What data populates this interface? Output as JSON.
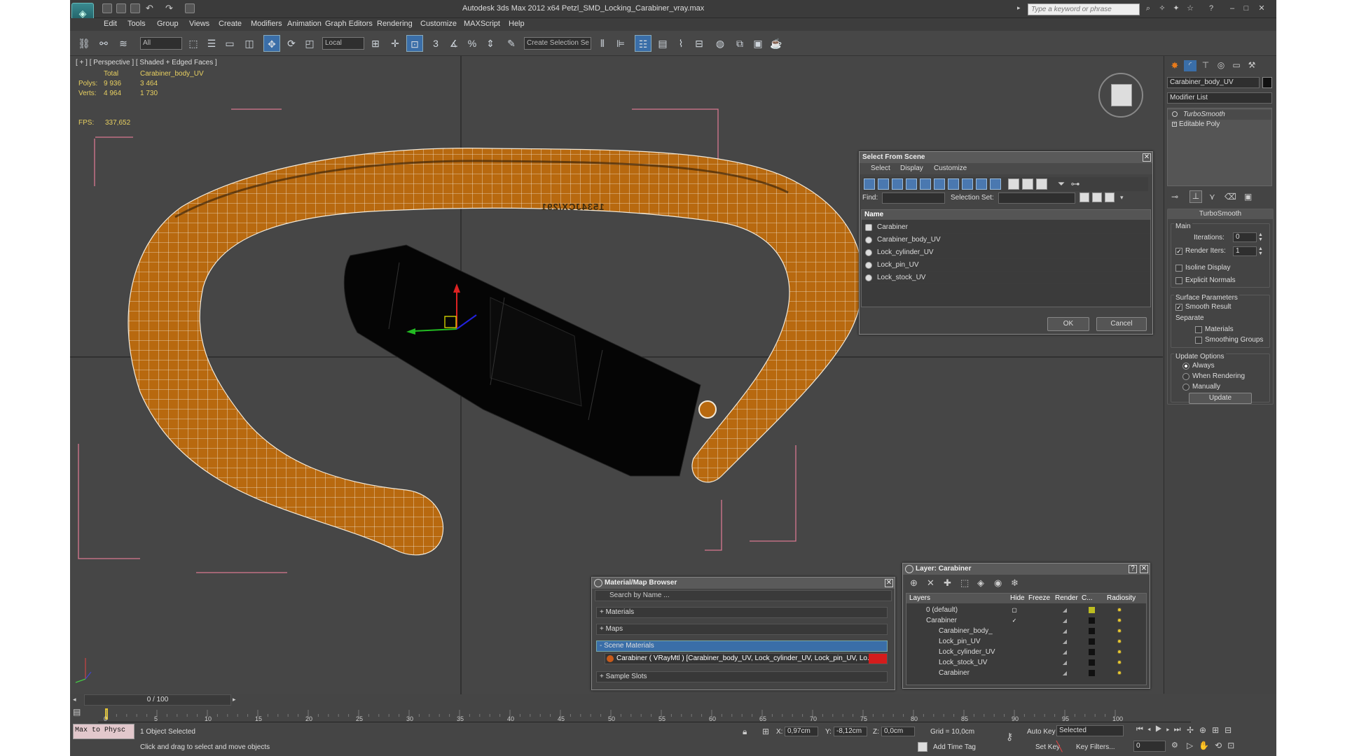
{
  "window": {
    "title": "Autodesk 3ds Max  2012 x64     Petzl_SMD_Locking_Carabiner_vray.max",
    "search_placeholder": "Type a keyword or phrase"
  },
  "menu": [
    "Edit",
    "Tools",
    "Group",
    "Views",
    "Create",
    "Modifiers",
    "Animation",
    "Graph Editors",
    "Rendering",
    "Customize",
    "MAXScript",
    "Help"
  ],
  "toolbar": {
    "filter": "All",
    "coord_system": "Local",
    "selection_set": "Create Selection Se",
    "snap_3": "3",
    "snap_pct": "%"
  },
  "viewport": {
    "label": "[ + ] [ Perspective ] [ Shaded + Edged Faces ]",
    "stats": {
      "total_label": "Total",
      "object_label": "Carabiner_body_UV",
      "polys_label": "Polys:",
      "polys_total": "9 936",
      "polys_obj": "3 464",
      "verts_label": "Verts:",
      "verts_total": "4 964",
      "verts_obj": "1 730",
      "fps_label": "FPS:",
      "fps_value": "337,652"
    },
    "engraving": "1534JCX/291"
  },
  "command_panel": {
    "object_name": "Carabiner_body_UV",
    "modifier_list": "Modifier List",
    "stack": [
      "TurboSmooth",
      "Editable Poly"
    ],
    "rollout_title": "TurboSmooth",
    "main_label": "Main",
    "iterations_label": "Iterations:",
    "iterations": "0",
    "render_iters_label": "Render Iters:",
    "render_iters": "1",
    "isoline": "Isoline Display",
    "explicit": "Explicit Normals",
    "surface_params": "Surface Parameters",
    "smooth_result": "Smooth Result",
    "separate": "Separate",
    "materials": "Materials",
    "smoothing_groups": "Smoothing Groups",
    "update_options": "Update Options",
    "always": "Always",
    "when_rendering": "When Rendering",
    "manually": "Manually",
    "update_btn": "Update"
  },
  "select_from_scene": {
    "title": "Select From Scene",
    "tabs": [
      "Select",
      "Display",
      "Customize"
    ],
    "find_label": "Find:",
    "selection_set_label": "Selection Set:",
    "col_name": "Name",
    "items": [
      "Carabiner",
      "Carabiner_body_UV",
      "Lock_cylinder_UV",
      "Lock_pin_UV",
      "Lock_stock_UV"
    ],
    "ok": "OK",
    "cancel": "Cancel"
  },
  "material_browser": {
    "title": "Material/Map Browser",
    "search_placeholder": "Search by Name ...",
    "sections": [
      "+ Materials",
      "+ Maps",
      "- Scene Materials",
      "+ Sample Slots"
    ],
    "material_item": "Carabiner ( VRayMtl ) [Carabiner_body_UV, Lock_cylinder_UV, Lock_pin_UV, Lo..."
  },
  "layer_window": {
    "title": "Layer: Carabiner",
    "cols": [
      "Layers",
      "Hide",
      "Freeze",
      "Render",
      "C...",
      "Radiosity"
    ],
    "rows": [
      "0 (default)",
      "Carabiner",
      "Carabiner_body_",
      "Lock_pin_UV",
      "Lock_cylinder_UV",
      "Lock_stock_UV",
      "Carabiner"
    ]
  },
  "timeline": {
    "frame": "0 / 100",
    "ticks": [
      "0",
      "5",
      "10",
      "15",
      "20",
      "25",
      "30",
      "35",
      "40",
      "45",
      "50",
      "55",
      "60",
      "65",
      "70",
      "75",
      "80",
      "85",
      "90",
      "95",
      "100"
    ]
  },
  "status": {
    "maxscript": "Max to Physc",
    "selected": "1 Object Selected",
    "prompt": "Click and drag to select and move objects",
    "x_label": "X:",
    "x": "0,97cm",
    "y_label": "Y:",
    "y": "-8,12cm",
    "z_label": "Z:",
    "z": "0,0cm",
    "grid": "Grid = 10,0cm",
    "add_time_tag": "Add Time Tag",
    "auto_key": "Auto Key",
    "set_key": "Set Key",
    "key_mode": "Selected",
    "key_filters": "Key Filters...",
    "frame_field": "0"
  },
  "colors": {
    "carabiner": "#b8690f",
    "wire": "#f3e9d8",
    "bbox": "#d87890"
  }
}
